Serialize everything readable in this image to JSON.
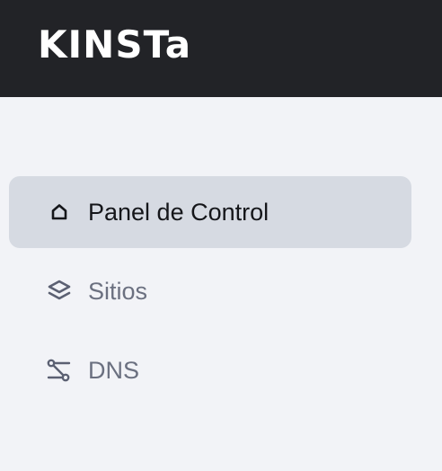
{
  "app": {
    "logo_text": "KINSTa"
  },
  "sidebar": {
    "items": [
      {
        "label": "Panel de Control",
        "icon": "home-icon",
        "active": true
      },
      {
        "label": "Sitios",
        "icon": "layers-icon",
        "active": false
      },
      {
        "label": "DNS",
        "icon": "dns-route-icon",
        "active": false
      }
    ]
  },
  "colors": {
    "topbar_bg": "#222327",
    "page_bg": "#f2f3f7",
    "active_item_bg": "#d6dae2",
    "active_text": "#15161a",
    "inactive_text": "#6b7080"
  }
}
